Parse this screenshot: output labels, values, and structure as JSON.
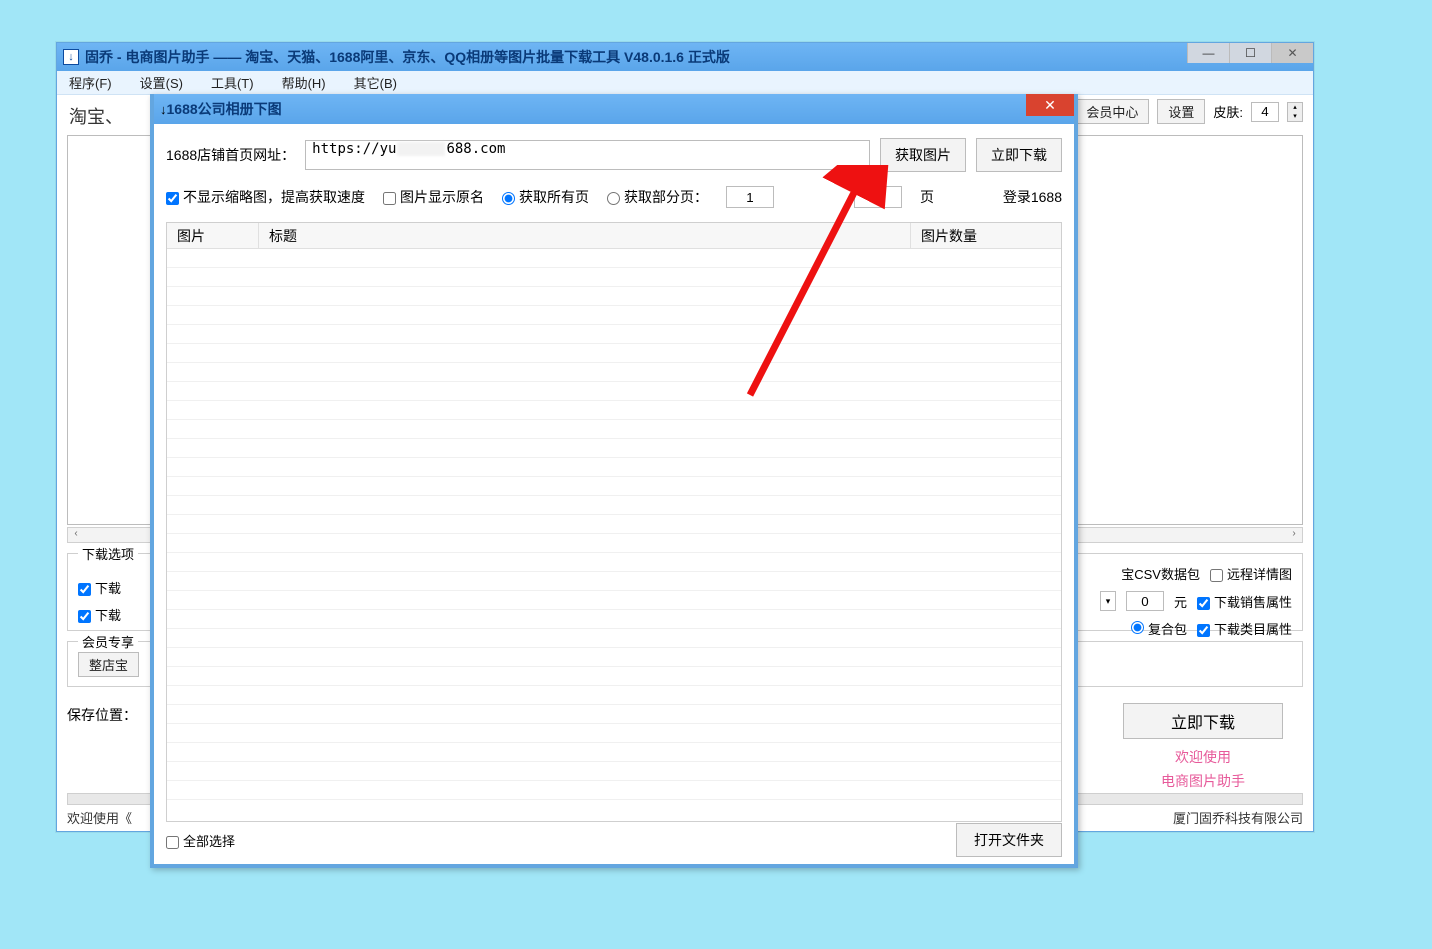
{
  "main_window": {
    "title": "固乔 - 电商图片助手 —— 淘宝、天猫、1688阿里、京东、QQ相册等图片批量下载工具 V48.0.1.6 正式版",
    "menus": [
      "程序(F)",
      "设置(S)",
      "工具(T)",
      "帮助(H)",
      "其它(B)"
    ],
    "tao_label": "淘宝、",
    "member_center": "会员中心",
    "settings_btn": "设置",
    "skin_label": "皮肤:",
    "skin_value": "4",
    "download_options_legend": "下载选项",
    "dl_chk1": "下载",
    "dl_chk2": "下载",
    "csv_label": "宝CSV数据包",
    "remote_detail": "远程详情图",
    "unit_yuan": "元",
    "zero": "0",
    "dl_sales_attr": "下载销售属性",
    "composite_pkg": "复合包",
    "dl_cat_attr": "下载类目属性",
    "member_exclusive_legend": "会员专享",
    "whole_shop": "整店宝",
    "download_now": "立即下载",
    "welcome1": "欢迎使用",
    "welcome2": "电商图片助手",
    "save_location": "保存位置：",
    "status_left": "欢迎使用《",
    "status_right": "厦门固乔科技有限公司"
  },
  "dialog": {
    "title": "1688公司相册下图",
    "url_label": "1688店铺首页网址：",
    "url_prefix": "https://yu",
    "url_suffix": "688.com",
    "get_images": "获取图片",
    "download_now": "立即下载",
    "no_thumbnail": "不显示缩略图，提高获取速度",
    "show_original_name": "图片显示原名",
    "get_all_pages": "获取所有页",
    "get_partial_pages": "获取部分页：",
    "page_from": "1",
    "page_to": "1",
    "page_unit": "页",
    "login_1688": "登录1688",
    "col_image": "图片",
    "col_title": "标题",
    "col_count": "图片数量",
    "select_all": "全部选择",
    "open_folder": "打开文件夹"
  }
}
